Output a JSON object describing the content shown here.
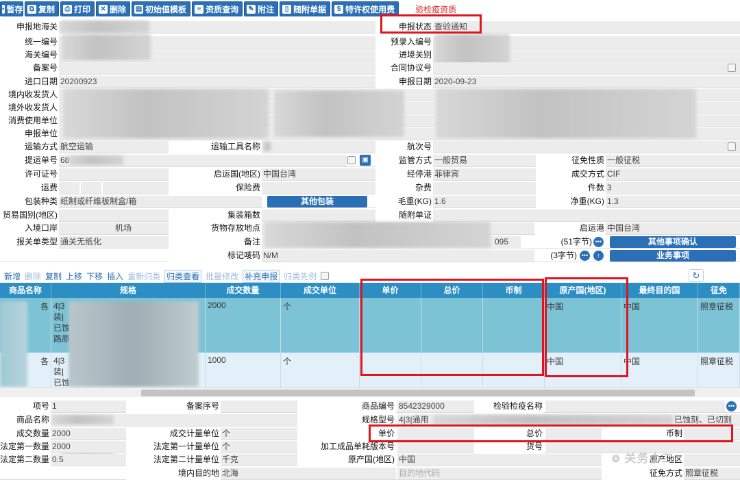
{
  "toolbar": {
    "buttons": [
      {
        "label": "暂存",
        "icon": "floppy-icon"
      },
      {
        "label": "复制",
        "icon": "copy-icon"
      },
      {
        "label": "打印",
        "icon": "printer-icon"
      },
      {
        "label": "删除",
        "icon": "trash-icon"
      },
      {
        "label": "初始值模板",
        "icon": "template-icon"
      },
      {
        "label": "资质查询",
        "icon": "doc-search-icon"
      },
      {
        "label": "附注",
        "icon": "note-icon"
      },
      {
        "label": "随附单据",
        "icon": "attachment-icon"
      },
      {
        "label": "特许权使用费",
        "icon": "dollar-icon"
      }
    ],
    "warning": "验检疫资质"
  },
  "form": {
    "customs_declare_place": "申报地海关",
    "declare_status_label": "申报状态",
    "declare_status_value": "查验通知",
    "unified_no": "统一编号",
    "pre_entry_no": "预录入编号",
    "customs_no": "海关编号",
    "entry_customs": "进境关别",
    "record_no": "备案号",
    "contract_no": "合同协议号",
    "import_date_label": "进口日期",
    "import_date": "20200923",
    "declare_date_label": "申报日期",
    "declare_date": "2020-09-23",
    "domestic_consignee": "境内收发货人",
    "overseas_consignee": "境外收发货人",
    "consumer_unit": "消费使用单位",
    "declare_unit": "申报单位",
    "transport_mode_label": "运输方式",
    "transport_mode": "航空运输",
    "transport_tool_label": "运输工具名称",
    "voyage_label": "航次号",
    "bill_no_label": "提运单号",
    "bill_no_prefix": "68",
    "supervision_label": "监管方式",
    "supervision": "一般贸易",
    "levy_nature_label": "征免性质",
    "levy_nature": "一般征税",
    "license_label": "许可证号",
    "departure_country_label": "启运国(地区)",
    "departure_country": "中国台湾",
    "stop_port_label": "经停港",
    "stop_port": "菲律宾",
    "deal_mode_label": "成交方式",
    "deal_mode": "CIF",
    "freight_label": "运费",
    "insurance_label": "保险费",
    "misc_fee_label": "杂费",
    "pieces_label": "件数",
    "pieces": "3",
    "packing_label": "包装种类",
    "packing": "纸制或纤维板制盒/箱",
    "other_packing_btn": "其他包装",
    "gross_weight_label": "毛重(KG)",
    "gross_weight": "1.6",
    "net_weight_label": "净重(KG)",
    "net_weight": "1.3",
    "trade_country_label": "贸易国别(地区)",
    "container_count_label": "集装箱数",
    "attached_docs_label": "随附单证",
    "entry_port_label": "入境口岸",
    "entry_port_value": "机场",
    "storage_place_label": "货物存放地点",
    "departure_port_label": "启运港",
    "departure_port": "中国台湾",
    "declaration_type_label": "报关单类型",
    "declaration_type": "通关无纸化",
    "remark_label": "备注",
    "remark_tail": "095",
    "remark_count": "(51字节)",
    "other_confirm_btn": "其他事项确认",
    "mark_label": "标记唛码",
    "mark_value": "N/M",
    "mark_count": "(3字节)",
    "business_btn": "业务事项"
  },
  "goods_toolbar": {
    "items": [
      "新增",
      "删除",
      "复制",
      "上移",
      "下移",
      "插入",
      "重新归类",
      "归类查看",
      "批量修改",
      "补充申报",
      "归类先例"
    ]
  },
  "goods_table": {
    "headers": [
      "商品名称",
      "规格",
      "成交数量",
      "成交单位",
      "单价",
      "总价",
      "币制",
      "原产国(地区)",
      "最终目的国",
      "征免"
    ],
    "rows": [
      {
        "name": "各",
        "spec_lines": [
          "4|3",
          "装|",
          "已蚀",
          "路原"
        ],
        "qty": "2000",
        "unit": "个",
        "price": "",
        "total": "",
        "currency": "",
        "origin": "中国",
        "dest": "中国",
        "levy": "照章征税"
      },
      {
        "name": "各",
        "spec_lines": [
          "4|3",
          "装|",
          "已蚀"
        ],
        "qty": "1000",
        "unit": "个",
        "price": "",
        "total": "",
        "currency": "",
        "origin": "中国",
        "dest": "中国",
        "levy": "照章征税"
      }
    ]
  },
  "detail": {
    "item_no_label": "项号",
    "item_no": "1",
    "record_seq_label": "备案序号",
    "hs_code_label": "商品编号",
    "hs_code": "8542329000",
    "inspection_name_label": "检验检疫名称",
    "goods_name_label": "商品名称",
    "spec_label": "规格型号",
    "spec_value": "4|3|通用",
    "spec_tail": "已蚀刻、已切割",
    "deal_qty_label": "成交数量",
    "deal_qty": "2000",
    "deal_unit_label": "成交计量单位",
    "deal_unit": "个",
    "unit_price_label": "单价",
    "total_price_label": "总价",
    "currency_label": "币制",
    "legal_qty1_label": "法定第一数量",
    "legal_qty1": "2000",
    "legal_unit1_label": "法定第一计量单位",
    "legal_unit1": "个",
    "processing_version_label": "加工成品单耗版本号",
    "goods_no_label": "货号",
    "legal_qty2_label": "法定第二数量",
    "legal_qty2": "0.5",
    "legal_unit2_label": "法定第二计量单位",
    "legal_unit2": "千克",
    "origin_country_label": "原产国(地区)",
    "origin_country": "中国",
    "origin_region_label": "原产地区",
    "domestic_dest_label": "境内目的地",
    "domestic_dest": "北海",
    "dest_code_placeholder": "目的地代码",
    "levy_mode_label": "征免方式",
    "levy_mode": "照章征税"
  },
  "watermark": "关务小二"
}
